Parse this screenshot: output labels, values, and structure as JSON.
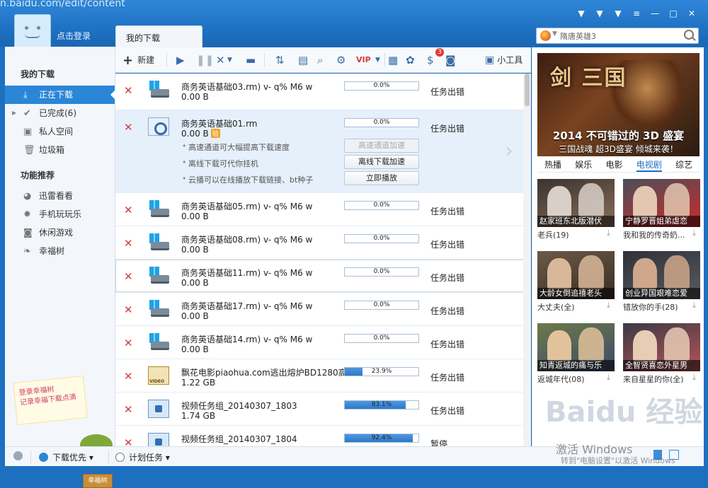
{
  "window": {
    "url_ghost": "n.baidu.com/edit/content",
    "login": "点击登录",
    "main_tab": "我的下载",
    "controls": [
      "skin-1",
      "skin-2",
      "skin-3",
      "menu",
      "minimize",
      "maximize",
      "close"
    ]
  },
  "search": {
    "value": "隋唐英雄3"
  },
  "sidebar": {
    "section1": "我的下载",
    "items": [
      {
        "label": "正在下载",
        "icon": "download-icon",
        "active": true
      },
      {
        "label": "已完成(6)",
        "icon": "check-icon",
        "active": false
      },
      {
        "label": "私人空间",
        "icon": "safe-icon",
        "active": false
      },
      {
        "label": "垃圾箱",
        "icon": "trash-icon",
        "active": false
      }
    ],
    "section2": "功能推荐",
    "features": [
      {
        "label": "迅雷看看",
        "icon": "kankan-icon"
      },
      {
        "label": "手机玩玩乐",
        "icon": "phone-icon"
      },
      {
        "label": "休闲游戏",
        "icon": "gamepad-icon"
      },
      {
        "label": "幸福树",
        "icon": "leaf-icon"
      }
    ],
    "promo_line1": "登录幸福树",
    "promo_line2": "记录幸福下载点滴",
    "tree_label": "幸福树"
  },
  "toolbar": {
    "new_label": "新建",
    "tools_label": "小工具",
    "badge_count": "3"
  },
  "tasks": [
    {
      "name": "商务英语基础03.rm) v- q% M6 w",
      "size": "0.00 B",
      "progress": 0.0,
      "pct": "0.0%",
      "status": "任务出错",
      "icon": "windows-disk"
    },
    {
      "name": "商务英语基础01.rm",
      "size": "0.00 B",
      "progress": 0.0,
      "pct": "0.0%",
      "status": "任务出错",
      "icon": "rm-file",
      "tag": "验",
      "tips": [
        "高速通道可大幅提高下载速度",
        "离线下载可代你挂机",
        "云播可以在线播放下载链接、bt种子"
      ],
      "buttons": [
        "高速通道加速",
        "离线下载加速",
        "立即播放"
      ]
    },
    {
      "name": "商务英语基础05.rm) v- q% M6 w",
      "size": "0.00 B",
      "progress": 0.0,
      "pct": "0.0%",
      "status": "任务出错",
      "icon": "windows-disk"
    },
    {
      "name": "商务英语基础08.rm) v- q% M6 w",
      "size": "0.00 B",
      "progress": 0.0,
      "pct": "0.0%",
      "status": "任务出错",
      "icon": "windows-disk"
    },
    {
      "name": "商务英语基础11.rm) v- q% M6 w",
      "size": "0.00 B",
      "progress": 0.0,
      "pct": "0.0%",
      "status": "任务出错",
      "icon": "windows-disk"
    },
    {
      "name": "商务英语基础17.rm) v- q% M6 w",
      "size": "0.00 B",
      "progress": 0.0,
      "pct": "0.0%",
      "status": "任务出错",
      "icon": "windows-disk"
    },
    {
      "name": "商务英语基础14.rm) v- q% M6 w",
      "size": "0.00 B",
      "progress": 0.0,
      "pct": "0.0%",
      "status": "任务出错",
      "icon": "windows-disk"
    },
    {
      "name": "飘花电影piaohua.com逃出熔炉BD1280高...",
      "size": "1.22 GB",
      "progress": 0.239,
      "pct": "23.9%",
      "status": "任务出错",
      "icon": "video-file"
    },
    {
      "name": "视频任务组_20140307_1803",
      "size": "1.74 GB",
      "progress": 0.831,
      "pct": "83.1%",
      "status": "任务出错",
      "icon": "group-file"
    },
    {
      "name": "视频任务组_20140307_1804",
      "size": "",
      "progress": 0.924,
      "pct": "92.4%",
      "status": "暂停",
      "icon": "group-file"
    }
  ],
  "ad": {
    "game_title": "剑 三国",
    "line1": "2014 不可错过的 3D 盛宴",
    "line2": "三国战魂 超3D盛宴 倾城来袭！"
  },
  "video_tabs": [
    {
      "label": "热播",
      "active": false
    },
    {
      "label": "娱乐",
      "active": false
    },
    {
      "label": "电影",
      "active": false
    },
    {
      "label": "电视剧",
      "active": true
    },
    {
      "label": "综艺",
      "active": false
    }
  ],
  "videos": [
    {
      "caption": "赵家班东北版潜伏",
      "title": "老兵(19)"
    },
    {
      "caption": "宁静罗晋姐弟虐恋",
      "title": "我和我的传奇奶..."
    },
    {
      "caption": "大龄女倒追禧老头",
      "title": "大丈夫(全)"
    },
    {
      "caption": "创业异国艰难恋爱",
      "title": "错放你的手(28)"
    },
    {
      "caption": "知青返城的痛与乐",
      "title": "返城年代(08)"
    },
    {
      "caption": "全智贤喜恋外星男",
      "title": "来自星星的你(全)"
    }
  ],
  "bottom": {
    "priority_label": "下载优先",
    "schedule_label": "计划任务"
  },
  "overlay": {
    "watermark": "Baidu 经验",
    "activate_title": "激活 Windows",
    "activate_sub": "转到\"电脑设置\"以激活 Windows"
  },
  "colors": {
    "titlebar": "#1d6fc0",
    "active_item": "#2a86d6",
    "progress": "#2c79c8",
    "error_x": "#d43b3b"
  }
}
